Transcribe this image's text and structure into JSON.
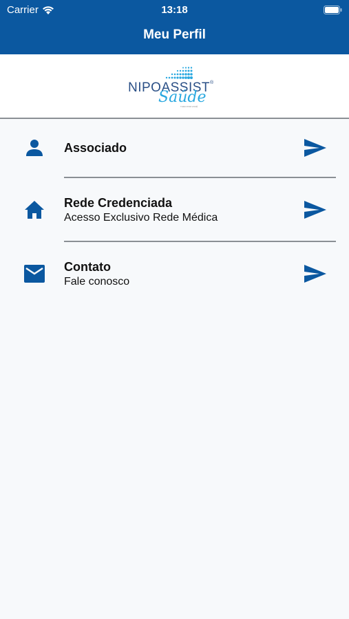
{
  "status_bar": {
    "carrier": "Carrier",
    "time": "13:18"
  },
  "header": {
    "title": "Meu Perfil"
  },
  "logo": {
    "brand": "NIPOASSIST",
    "script": "Saúde",
    "tagline": "TUDO POR VOCÊ"
  },
  "colors": {
    "primary": "#0b58a0",
    "background": "#f7f9fb"
  },
  "menu": [
    {
      "title": "Associado",
      "subtitle": "",
      "icon": "person-icon",
      "action_icon": "send-arrow-icon"
    },
    {
      "title": "Rede Credenciada",
      "subtitle": "Acesso Exclusivo Rede Médica",
      "icon": "home-icon",
      "action_icon": "send-arrow-icon"
    },
    {
      "title": "Contato",
      "subtitle": "Fale conosco",
      "icon": "mail-icon",
      "action_icon": "send-arrow-icon"
    }
  ]
}
